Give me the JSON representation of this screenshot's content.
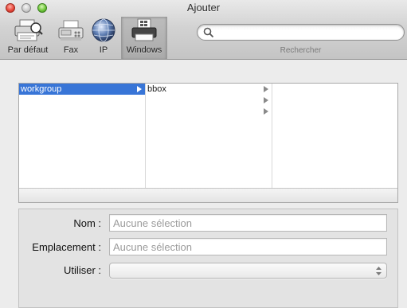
{
  "window": {
    "title": "Ajouter"
  },
  "toolbar": {
    "items": [
      {
        "label": "Par défaut"
      },
      {
        "label": "Fax"
      },
      {
        "label": "IP"
      },
      {
        "label": "Windows"
      }
    ],
    "search": {
      "value": "",
      "placeholder": "",
      "label": "Rechercher"
    }
  },
  "browser": {
    "columns": [
      [
        {
          "label": "workgroup",
          "selected": true
        }
      ],
      [
        {
          "label": "bbox"
        },
        {
          "label": ""
        },
        {
          "label": ""
        }
      ],
      []
    ]
  },
  "form": {
    "name_label": "Nom :",
    "name_placeholder": "Aucune sélection",
    "location_label": "Emplacement :",
    "location_placeholder": "Aucune sélection",
    "use_label": "Utiliser :",
    "use_value": ""
  },
  "colors": {
    "selection": "#3875d7",
    "window_bg": "#ececec"
  }
}
